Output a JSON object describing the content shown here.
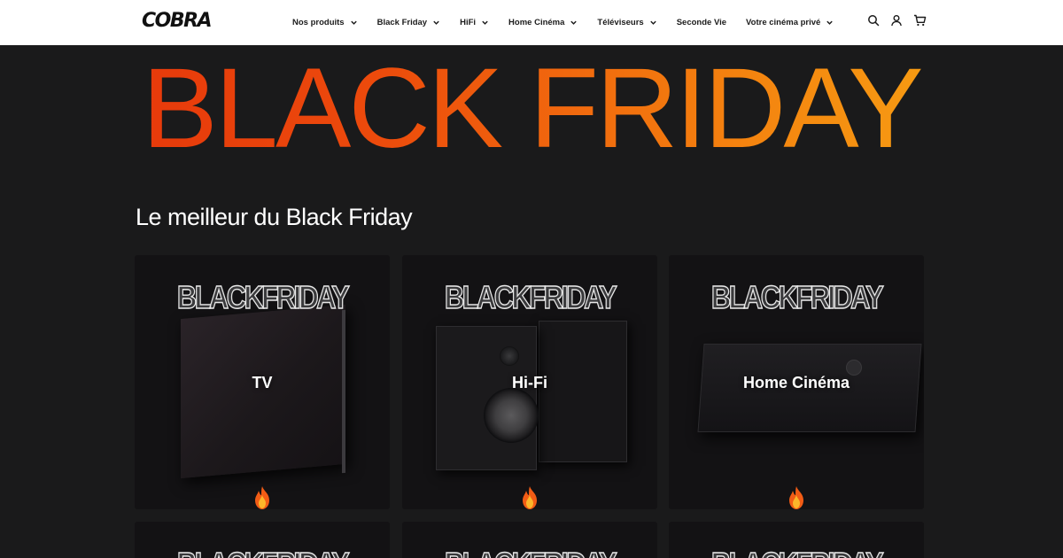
{
  "header": {
    "logo": "COBRA",
    "nav": [
      {
        "label": "Nos produits",
        "has_dropdown": true
      },
      {
        "label": "Black Friday",
        "has_dropdown": true
      },
      {
        "label": "HiFi",
        "has_dropdown": true
      },
      {
        "label": "Home Cinéma",
        "has_dropdown": true
      },
      {
        "label": "Téléviseurs",
        "has_dropdown": true
      },
      {
        "label": "Seconde Vie",
        "has_dropdown": false
      },
      {
        "label": "Votre cinéma privé",
        "has_dropdown": true
      }
    ],
    "icons": [
      "search-icon",
      "account-icon",
      "cart-icon"
    ]
  },
  "hero": {
    "title": "BLACK FRIDAY",
    "gradient": [
      "#e3300a",
      "#f8ac15"
    ]
  },
  "section": {
    "title": "Le meilleur du Black Friday"
  },
  "cards": [
    {
      "badge": "BLACKFRIDAY",
      "label": "TV",
      "icon": "fire-icon"
    },
    {
      "badge": "BLACKFRIDAY",
      "label": "Hi-Fi",
      "icon": "fire-icon"
    },
    {
      "badge": "BLACKFRIDAY",
      "label": "Home Cinéma",
      "icon": "fire-icon"
    },
    {
      "badge": "BLACKFRIDAY"
    },
    {
      "badge": "BLACKFRIDAY"
    },
    {
      "badge": "BLACKFRIDAY"
    }
  ],
  "colors": {
    "background": "#1a1a1b",
    "card": "#131214",
    "header": "#ffffff"
  }
}
